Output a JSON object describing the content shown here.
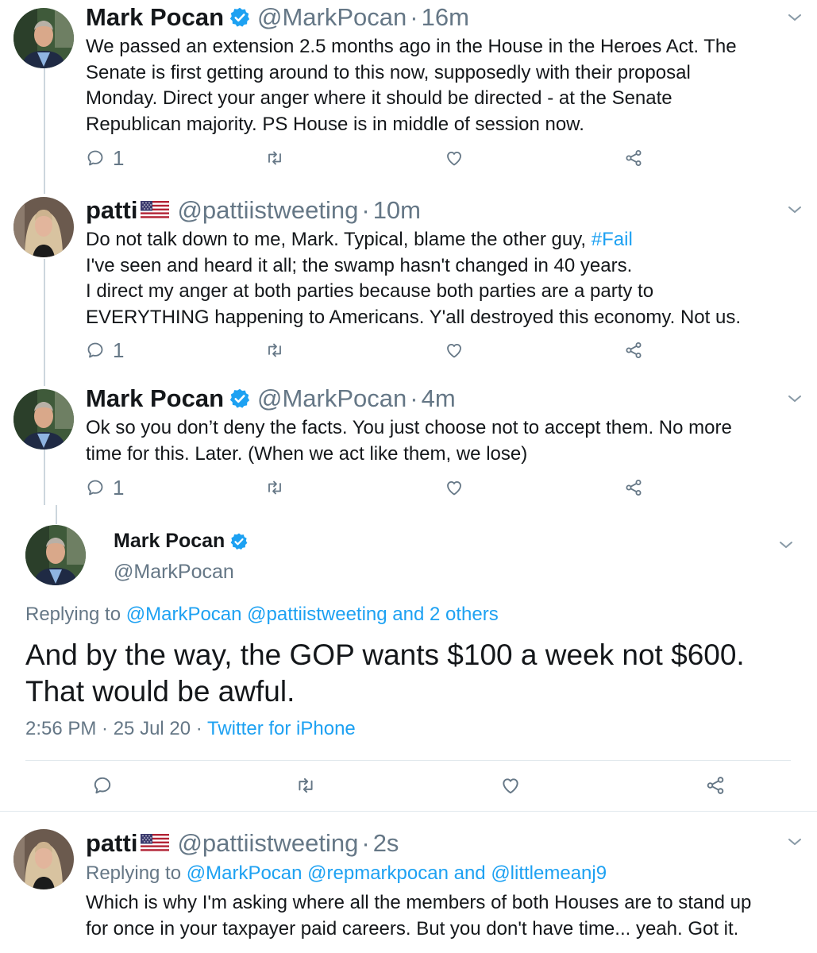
{
  "tweets": [
    {
      "name": "Mark Pocan",
      "handle": "@MarkPocan",
      "time": "16m",
      "verified": true,
      "lines": [
        "We passed an extension 2.5 months ago in the House in the Heroes Act. The",
        "Senate is first getting around to this now, supposedly with their proposal",
        "Monday. Direct your anger where it should be directed - at the Senate",
        "Republican majority. PS House is in middle of session now."
      ],
      "reply_count": "1"
    },
    {
      "name": "patti",
      "handle": "@pattiistweeting",
      "time": "10m",
      "verified": false,
      "line1_text": "Do not talk down to me, Mark. Typical, blame the other guy, ",
      "line1_hashtag": "#Fail",
      "lines": [
        "I've seen and heard it all; the swamp hasn't changed in 40 years.",
        "I direct my anger at both parties because both parties are a party to",
        "EVERYTHING happening to Americans. Y'all destroyed this economy. Not us."
      ],
      "reply_count": "1"
    },
    {
      "name": "Mark Pocan",
      "handle": "@MarkPocan",
      "time": "4m",
      "verified": true,
      "lines": [
        "Ok so you don’t deny the facts. You just choose not to accept them. No more",
        "time for this. Later. (When we act like them, we lose)"
      ],
      "reply_count": "1"
    }
  ],
  "main_tweet": {
    "name": "Mark Pocan",
    "handle": "@MarkPocan",
    "replying_prefix": "Replying to ",
    "replying_to": "@MarkPocan @pattiistweeting and 2 others",
    "lines": [
      "And by the way, the GOP wants $100 a week not $600.",
      "That would be awful."
    ],
    "timestamp": "2:56 PM · 25 Jul 20 · ",
    "source": "Twitter for iPhone"
  },
  "last_tweet": {
    "name": "patti",
    "handle": "@pattiistweeting",
    "time": "2s",
    "replying_prefix": "Replying to ",
    "replying_to": "@MarkPocan @repmarkpocan and @littlemeanj9",
    "lines": [
      "Which is why I'm asking where all the members of both Houses are to stand up",
      "for once in your taxpayer paid careers. But you don't have time... yeah. Got it."
    ]
  },
  "separator": "·",
  "icons": {
    "reply": "reply-icon",
    "retweet": "retweet-icon",
    "like": "heart-icon",
    "share": "share-icon",
    "more": "chevron-down-icon",
    "verified": "verified-badge-icon",
    "flag": "us-flag-icon"
  },
  "colors": {
    "link": "#1da1f2",
    "text": "#14171a",
    "muted": "#657786",
    "line": "#ccd6dd"
  }
}
